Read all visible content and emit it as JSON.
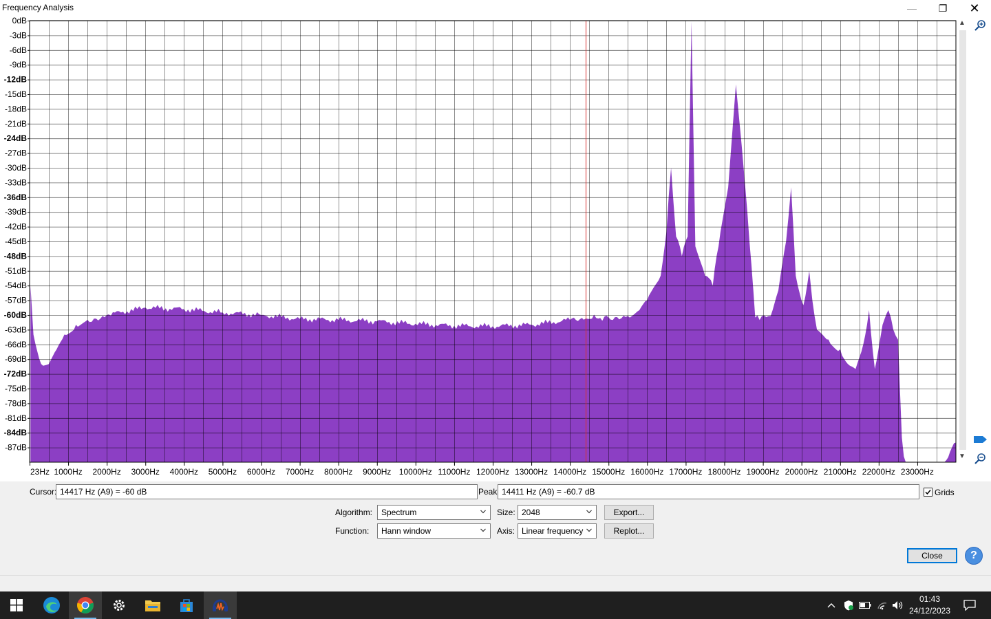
{
  "window": {
    "title": "Frequency Analysis",
    "min_glyph": "—",
    "max_glyph": "❐",
    "close_glyph": "✕"
  },
  "chart_data": {
    "type": "area",
    "xlabel": "",
    "ylabel": "",
    "grid": true,
    "x_scale": "linear",
    "xlim": [
      23,
      24000
    ],
    "ylim": [
      -90,
      0
    ],
    "y_ticks": [
      "0dB",
      "-3dB",
      "-6dB",
      "-9dB",
      "-12dB",
      "-15dB",
      "-18dB",
      "-21dB",
      "-24dB",
      "-27dB",
      "-30dB",
      "-33dB",
      "-36dB",
      "-39dB",
      "-42dB",
      "-45dB",
      "-48dB",
      "-51dB",
      "-54dB",
      "-57dB",
      "-60dB",
      "-63dB",
      "-66dB",
      "-69dB",
      "-72dB",
      "-75dB",
      "-78dB",
      "-81dB",
      "-84dB",
      "-87dB"
    ],
    "x_ticks": [
      {
        "label": "23Hz",
        "value": 23
      },
      {
        "label": "1000Hz",
        "value": 1000
      },
      {
        "label": "2000Hz",
        "value": 2000
      },
      {
        "label": "3000Hz",
        "value": 3000
      },
      {
        "label": "4000Hz",
        "value": 4000
      },
      {
        "label": "5000Hz",
        "value": 5000
      },
      {
        "label": "6000Hz",
        "value": 6000
      },
      {
        "label": "7000Hz",
        "value": 7000
      },
      {
        "label": "8000Hz",
        "value": 8000
      },
      {
        "label": "9000Hz",
        "value": 9000
      },
      {
        "label": "10000Hz",
        "value": 10000
      },
      {
        "label": "11000Hz",
        "value": 11000
      },
      {
        "label": "12000Hz",
        "value": 12000
      },
      {
        "label": "13000Hz",
        "value": 13000
      },
      {
        "label": "14000Hz",
        "value": 14000
      },
      {
        "label": "15000Hz",
        "value": 15000
      },
      {
        "label": "16000Hz",
        "value": 16000
      },
      {
        "label": "17000Hz",
        "value": 17000
      },
      {
        "label": "18000Hz",
        "value": 18000
      },
      {
        "label": "19000Hz",
        "value": 19000
      },
      {
        "label": "20000Hz",
        "value": 20000
      },
      {
        "label": "21000Hz",
        "value": 21000
      },
      {
        "label": "22000Hz",
        "value": 22000
      },
      {
        "label": "23000Hz",
        "value": 23000
      }
    ],
    "series": [
      {
        "color": "#8c3fc4",
        "points": [
          [
            23,
            -54
          ],
          [
            100,
            -64
          ],
          [
            300,
            -70
          ],
          [
            500,
            -70
          ],
          [
            700,
            -67
          ],
          [
            900,
            -64
          ],
          [
            1200,
            -62
          ],
          [
            1500,
            -61
          ],
          [
            2000,
            -60
          ],
          [
            3000,
            -58.5
          ],
          [
            4000,
            -58.8
          ],
          [
            5000,
            -59.5
          ],
          [
            6000,
            -60
          ],
          [
            7000,
            -60.8
          ],
          [
            8000,
            -61
          ],
          [
            9000,
            -61.3
          ],
          [
            10000,
            -61.8
          ],
          [
            11000,
            -62.2
          ],
          [
            12000,
            -62.3
          ],
          [
            13000,
            -62
          ],
          [
            14000,
            -61
          ],
          [
            14411,
            -60.7
          ],
          [
            15000,
            -60.5
          ],
          [
            15500,
            -60.2
          ],
          [
            15800,
            -59
          ],
          [
            16000,
            -57
          ],
          [
            16200,
            -54
          ],
          [
            16350,
            -52
          ],
          [
            16500,
            -43
          ],
          [
            16620,
            -30
          ],
          [
            16750,
            -44
          ],
          [
            16900,
            -48
          ],
          [
            17050,
            -44
          ],
          [
            17150,
            -0.2
          ],
          [
            17250,
            -46
          ],
          [
            17500,
            -52
          ],
          [
            17700,
            -54
          ],
          [
            17850,
            -46
          ],
          [
            18100,
            -34
          ],
          [
            18300,
            -13
          ],
          [
            18500,
            -30
          ],
          [
            18650,
            -45
          ],
          [
            18800,
            -60.5
          ],
          [
            19200,
            -60.2
          ],
          [
            19400,
            -55
          ],
          [
            19600,
            -45
          ],
          [
            19730,
            -34
          ],
          [
            19850,
            -52
          ],
          [
            20050,
            -58
          ],
          [
            20200,
            -51
          ],
          [
            20280,
            -57
          ],
          [
            20400,
            -63
          ],
          [
            20700,
            -65
          ],
          [
            21000,
            -67
          ],
          [
            21200,
            -70
          ],
          [
            21400,
            -71
          ],
          [
            21600,
            -66
          ],
          [
            21750,
            -59
          ],
          [
            21900,
            -71
          ],
          [
            22100,
            -62
          ],
          [
            22250,
            -59
          ],
          [
            22380,
            -63
          ],
          [
            22500,
            -65
          ],
          [
            22600,
            -85
          ],
          [
            22700,
            -92
          ],
          [
            23600,
            -92
          ],
          [
            23800,
            -89
          ],
          [
            24000,
            -86
          ]
        ]
      }
    ],
    "cursor_line": {
      "x": 14417,
      "color": "#d93030"
    }
  },
  "readouts": {
    "cursor_label": "Cursor:",
    "cursor_value": "14417 Hz (A9) = -60 dB",
    "peak_label": "Peak:",
    "peak_value": "14411 Hz (A9) = -60.7 dB",
    "grids_label": "Grids",
    "grids_checked": true
  },
  "controls": {
    "algorithm_label": "Algorithm:",
    "algorithm_value": "Spectrum",
    "function_label": "Function:",
    "function_value": "Hann window",
    "size_label": "Size:",
    "size_value": "2048",
    "axis_label": "Axis:",
    "axis_value": "Linear frequency",
    "export_label": "Export...",
    "replot_label": "Replot...",
    "close_label": "Close",
    "help_label": "?"
  },
  "taskbar": {
    "clock_time": "01:43",
    "clock_date": "24/12/2023",
    "apps": [
      "start-icon",
      "edge-icon",
      "chrome-icon",
      "settings-icon",
      "file-explorer-icon",
      "store-icon",
      "audacity-icon"
    ]
  }
}
